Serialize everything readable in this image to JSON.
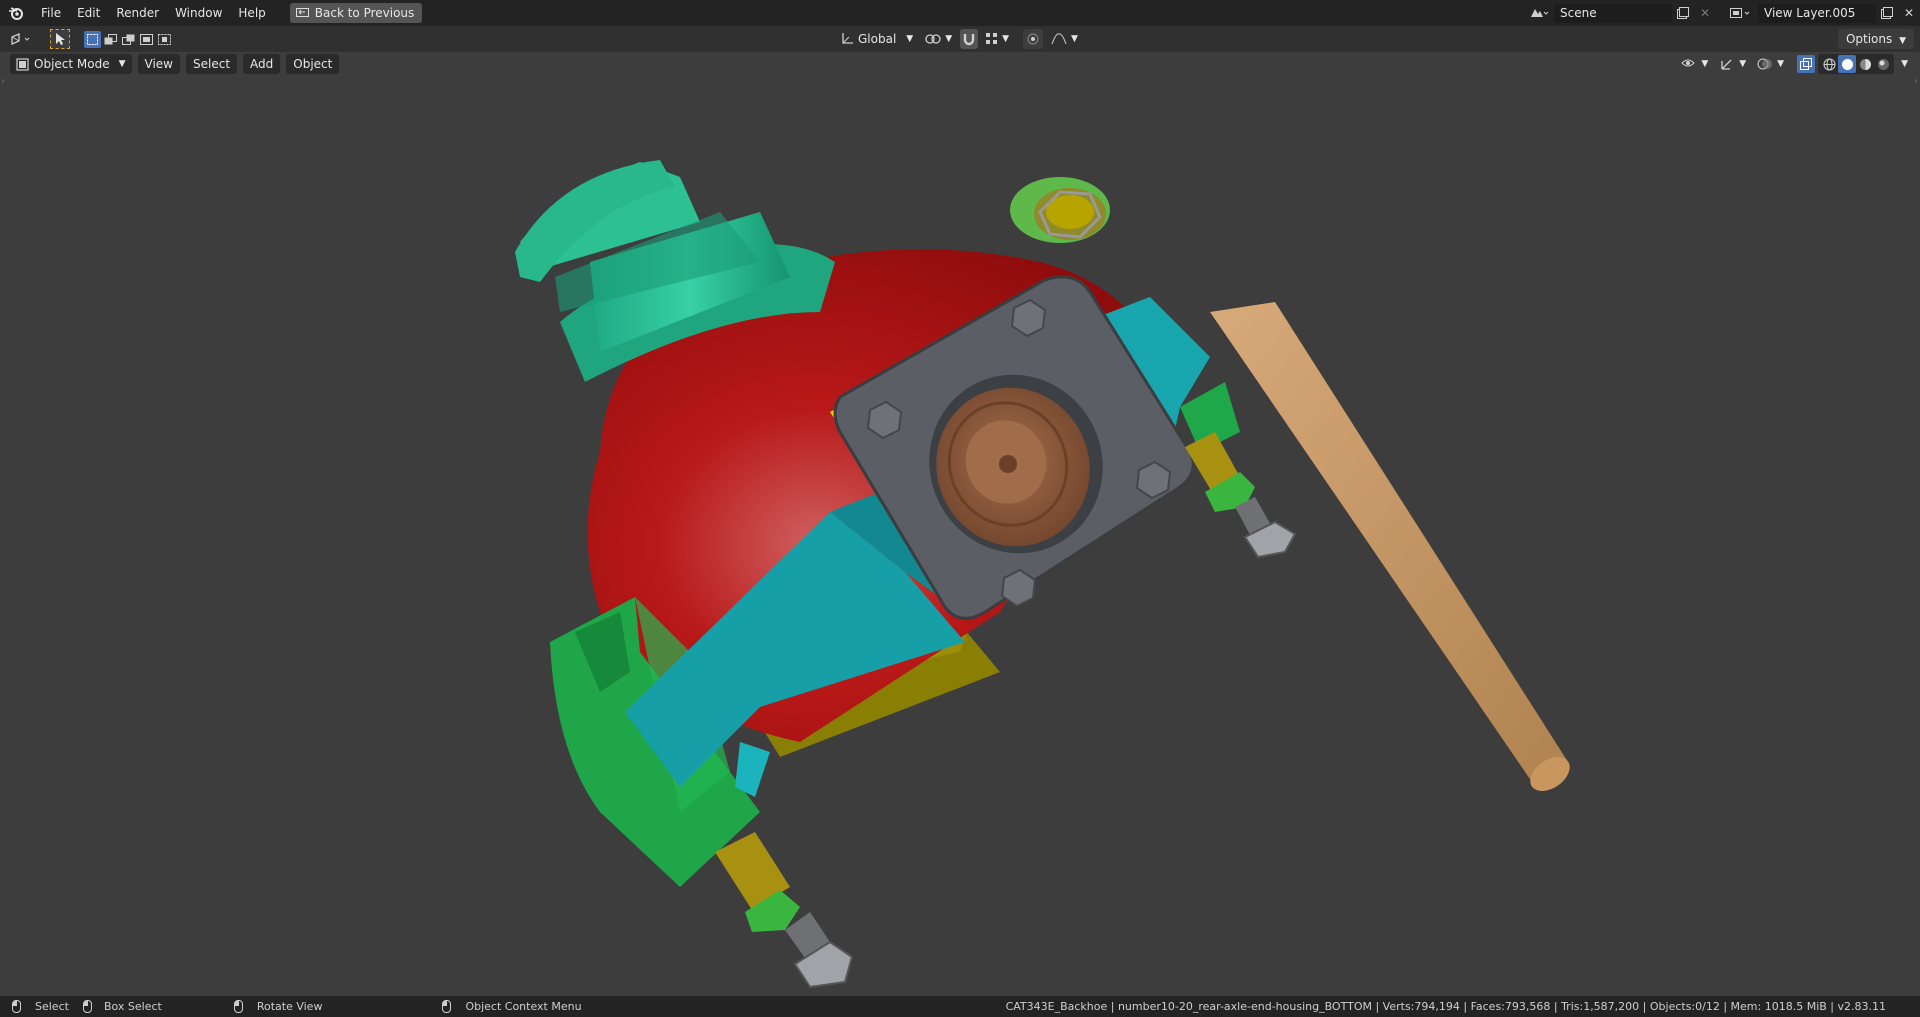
{
  "topbar": {
    "menus": [
      "File",
      "Edit",
      "Render",
      "Window",
      "Help"
    ],
    "back_label": "Back to Previous",
    "scene_name": "Scene",
    "view_layer": "View Layer.005"
  },
  "toolbar": {
    "orientation": "Global",
    "options_label": "Options"
  },
  "viewport": {
    "mode": "Object Mode",
    "menus": [
      "View",
      "Select",
      "Add",
      "Object"
    ]
  },
  "statusbar": {
    "hint_select": "Select",
    "hint_box_select": "Box Select",
    "hint_rotate": "Rotate View",
    "hint_context": "Object Context Menu",
    "stats": "CAT343E_Backhoe | number10-20_rear-axle-end-housing_BOTTOM | Verts:794,194 | Faces:793,568 | Tris:1,587,200 | Objects:0/12 | Mem: 1018.5 MiB | v2.83.11"
  },
  "colors": {
    "accent": "#4772b3",
    "background": "#3d3d3d",
    "housing_red": "#b51414",
    "teal": "#18a0a8",
    "green": "#1faa4a",
    "mint": "#1fb585",
    "yellow": "#8a8000",
    "flange_gray": "#5d6066",
    "bearing_brown": "#8b5a3c",
    "rod_tan": "#c09063"
  }
}
